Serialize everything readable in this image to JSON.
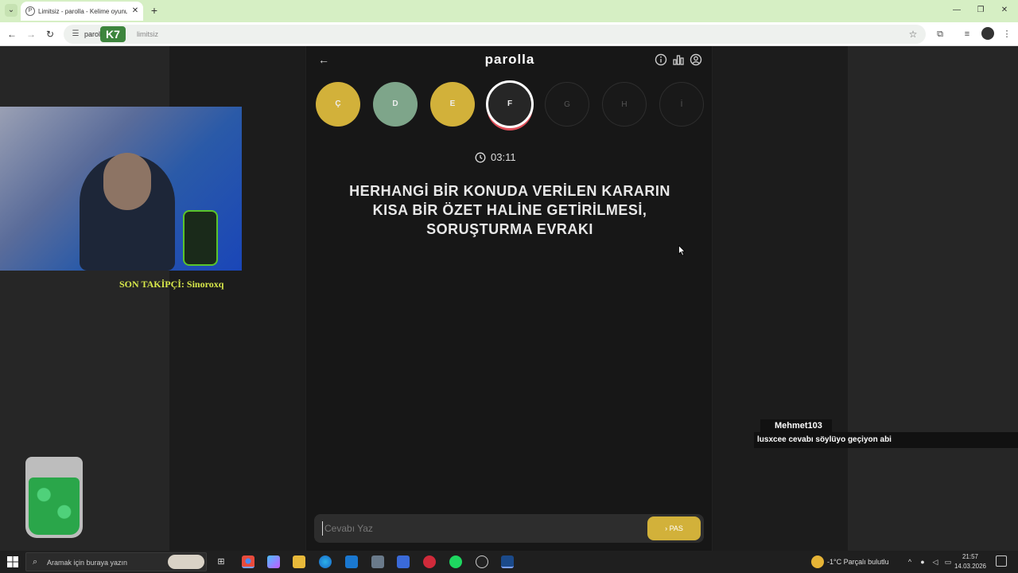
{
  "browser": {
    "tab_title": "Limitsiz - parolla - Kelime oyunu",
    "url_prefix": "paroll",
    "url_suffix": "limitsiz",
    "overlay_logo": "K7"
  },
  "app": {
    "title": "parolla",
    "letters": [
      {
        "label": "Ç",
        "state": "correct-yellow"
      },
      {
        "label": "D",
        "state": "correct-green"
      },
      {
        "label": "E",
        "state": "correct-yellow"
      },
      {
        "label": "F",
        "state": "active"
      },
      {
        "label": "G",
        "state": "pending"
      },
      {
        "label": "H",
        "state": "pending"
      },
      {
        "label": "İ",
        "state": "pending"
      }
    ],
    "timer": "03:11",
    "question": "HERHANGİ BİR KONUDA VERİLEN KARARIN KISA BİR ÖZET HALİNE GETİRİLMESİ, SORUŞTURMA EVRAKI",
    "answer_placeholder": "Cevabı Yaz",
    "pass_label": "PAS"
  },
  "stream": {
    "last_follower": "SON TAKİPÇİ: Sinoroxq",
    "chat_user": "Mehmet103",
    "chat_message": "lusxcee cevabı söylüyo geçiyon abi"
  },
  "taskbar": {
    "search_placeholder": "Aramak için buraya yazın",
    "weather": "-1°C  Parçalı bulutlu",
    "time": "21:57",
    "date": "14.03.2026"
  },
  "colors": {
    "accent_yellow": "#d2b13a",
    "accent_green": "#7ea58a",
    "active_ring": "#e0505a"
  }
}
